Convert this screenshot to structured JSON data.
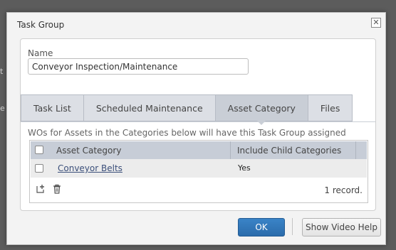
{
  "background": {
    "frag_1": "t",
    "frag_2": "e"
  },
  "dialog": {
    "title": "Task Group",
    "close_symbol": "✕",
    "name_label": "Name",
    "name_value": "Conveyor Inspection/Maintenance"
  },
  "tabs": [
    {
      "label": "Task List",
      "active": false
    },
    {
      "label": "Scheduled Maintenance",
      "active": false
    },
    {
      "label": "Asset Category",
      "active": true
    },
    {
      "label": "Files",
      "active": false
    }
  ],
  "asset_category": {
    "description": "WOs for Assets in the Categories below will have this Task Group assigned",
    "columns": [
      "Asset Category",
      "Include Child Categories"
    ],
    "rows": [
      {
        "category": "Conveyor Belts",
        "include_child": "Yes"
      }
    ],
    "record_count": "1 record."
  },
  "buttons": {
    "ok": "OK",
    "help": "Show Video Help"
  },
  "colors": {
    "primary": "#2b6cab",
    "header": "#c7cdd7",
    "tab": "#dcdfe5"
  }
}
